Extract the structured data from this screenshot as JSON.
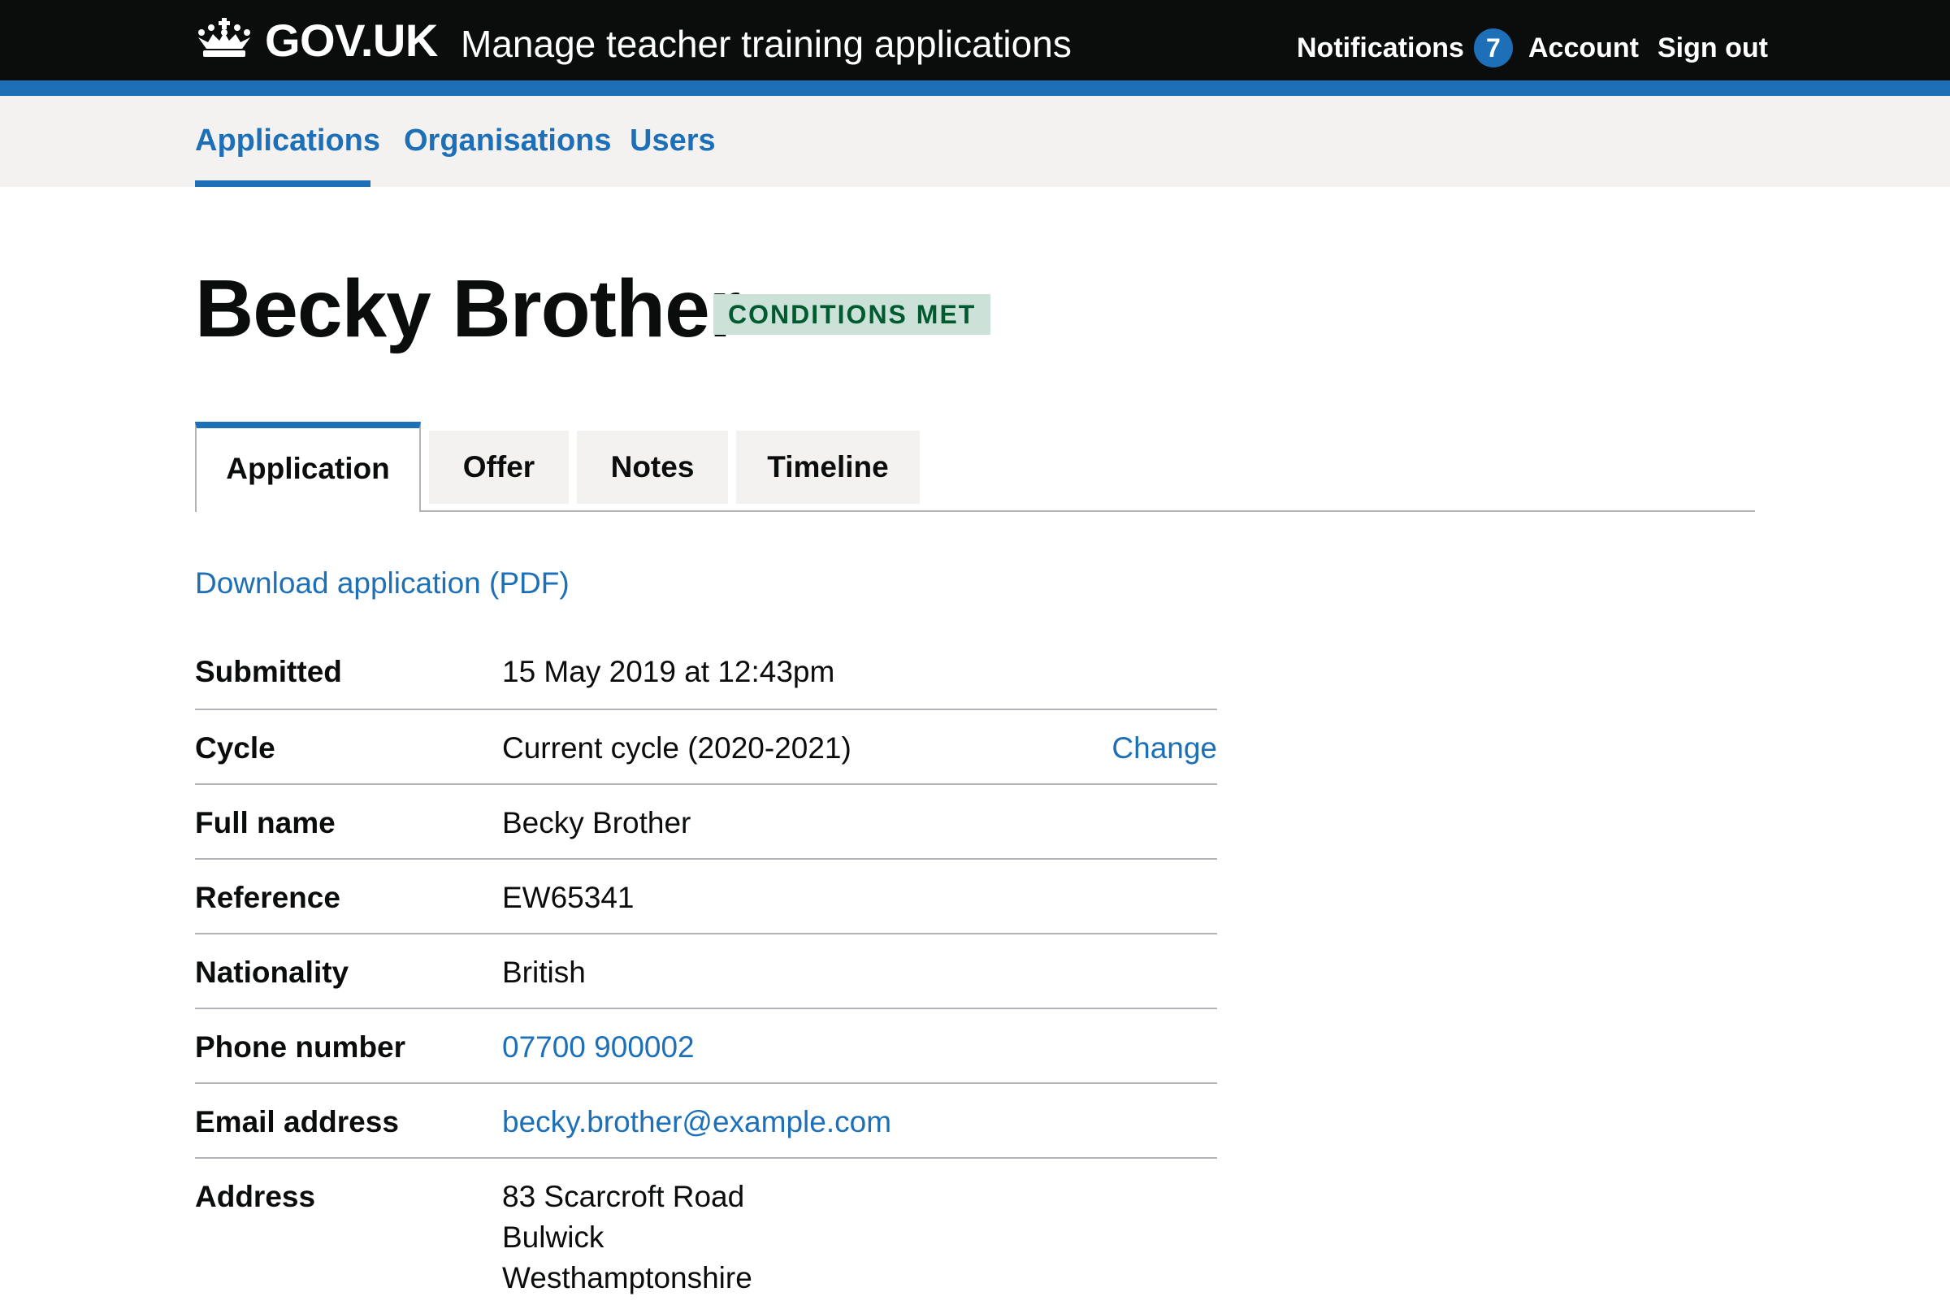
{
  "header": {
    "logo_text": "GOV.UK",
    "service_name": "Manage teacher training applications",
    "notifications_label": "Notifications",
    "notifications_count": "7",
    "account_label": "Account",
    "sign_out_label": "Sign out"
  },
  "subnav": {
    "items": [
      {
        "label": "Applications",
        "current": true
      },
      {
        "label": "Organisations",
        "current": false
      },
      {
        "label": "Users",
        "current": false
      }
    ]
  },
  "page": {
    "title": "Becky Brother",
    "status": "CONDITIONS MET"
  },
  "tabs": [
    {
      "label": "Application",
      "selected": true
    },
    {
      "label": "Offer",
      "selected": false
    },
    {
      "label": "Notes",
      "selected": false
    },
    {
      "label": "Timeline",
      "selected": false
    }
  ],
  "download_link": "Download application (PDF)",
  "summary": {
    "submitted": {
      "key": "Submitted",
      "value": "15 May 2019 at 12:43pm"
    },
    "cycle": {
      "key": "Cycle",
      "value": "Current cycle (2020-2021)",
      "action": "Change"
    },
    "full_name": {
      "key": "Full name",
      "value": "Becky Brother"
    },
    "reference": {
      "key": "Reference",
      "value": "EW65341"
    },
    "nationality": {
      "key": "Nationality",
      "value": "British"
    },
    "phone": {
      "key": "Phone number",
      "value": "07700 900002"
    },
    "email": {
      "key": "Email address",
      "value": "becky.brother@example.com"
    },
    "address": {
      "key": "Address",
      "lines": [
        "83 Scarcroft Road",
        "Bulwick",
        "Westhamptonshire"
      ]
    }
  },
  "colors": {
    "header_bg": "#0b0c0c",
    "brand_blue": "#1d70b8",
    "link": "#1d70b8",
    "subnav_bg": "#f3f2f1",
    "tag_bg": "#cce2d8",
    "tag_text": "#005a30",
    "border": "#b1b4b6"
  },
  "icons": {
    "logo": "crown-icon"
  }
}
